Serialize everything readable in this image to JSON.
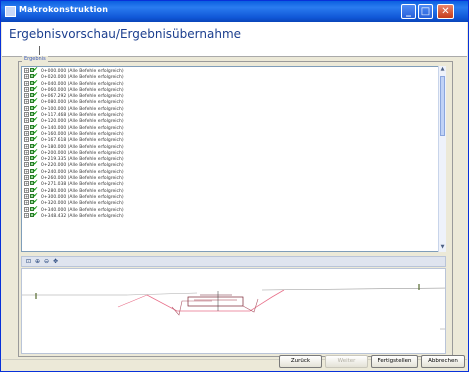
{
  "window": {
    "title": "Makrokonstruktion"
  },
  "header": {
    "title": "Ergebnisvorschau/Ergebnisübernahme"
  },
  "group": {
    "label": "Ergebnis"
  },
  "results": {
    "items": [
      "0+000.000 (Alle Befehle erfolgreich)",
      "0+020.000 (Alle Befehle erfolgreich)",
      "0+040.000 (Alle Befehle erfolgreich)",
      "0+060.000 (Alle Befehle erfolgreich)",
      "0+067.292 (Alle Befehle erfolgreich)",
      "0+080.000 (Alle Befehle erfolgreich)",
      "0+100.000 (Alle Befehle erfolgreich)",
      "0+117.468 (Alle Befehle erfolgreich)",
      "0+120.000 (Alle Befehle erfolgreich)",
      "0+140.000 (Alle Befehle erfolgreich)",
      "0+160.000 (Alle Befehle erfolgreich)",
      "0+167.618 (Alle Befehle erfolgreich)",
      "0+180.000 (Alle Befehle erfolgreich)",
      "0+200.000 (Alle Befehle erfolgreich)",
      "0+219.335 (Alle Befehle erfolgreich)",
      "0+220.000 (Alle Befehle erfolgreich)",
      "0+240.000 (Alle Befehle erfolgreich)",
      "0+260.000 (Alle Befehle erfolgreich)",
      "0+271.038 (Alle Befehle erfolgreich)",
      "0+280.000 (Alle Befehle erfolgreich)",
      "0+300.000 (Alle Befehle erfolgreich)",
      "0+320.000 (Alle Befehle erfolgreich)",
      "0+340.000 (Alle Befehle erfolgreich)",
      "0+348.432 (Alle Befehle erfolgreich)"
    ],
    "expand_glyph": "+",
    "check_glyph": "✔"
  },
  "preview_toolbar": {
    "icons": [
      "zoom-fit-icon",
      "zoom-in-icon",
      "zoom-out-icon",
      "pan-icon"
    ],
    "glyphs": [
      "⊡",
      "⊕",
      "⊖",
      "✥"
    ]
  },
  "buttons": {
    "back": "Zurück",
    "next": "Weiter",
    "finish": "Fertigstellen",
    "cancel": "Abbrechen"
  },
  "titlebar_buttons": {
    "minimize": "_",
    "maximize": "□",
    "close": "✕"
  }
}
